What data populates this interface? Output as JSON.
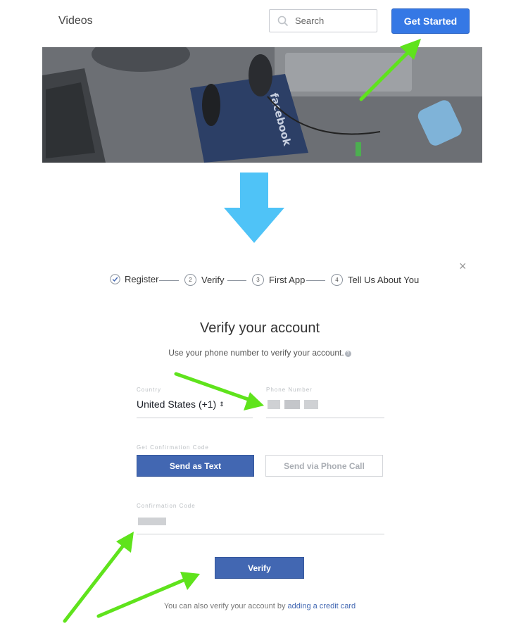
{
  "nav": {
    "videos_label": "Videos",
    "search_label": "Search",
    "get_started_label": "Get Started"
  },
  "hero": {
    "brand_text": "facebook"
  },
  "steps": [
    {
      "number": "",
      "label": "Register",
      "state": "done"
    },
    {
      "number": "2",
      "label": "Verify",
      "state": "current"
    },
    {
      "number": "3",
      "label": "First App",
      "state": "pending"
    },
    {
      "number": "4",
      "label": "Tell Us About You",
      "state": "pending"
    }
  ],
  "modal": {
    "close_icon": "×",
    "title": "Verify your account",
    "subtitle": "Use your phone number to verify your account.",
    "help_icon": "?"
  },
  "form": {
    "country_label": "Country",
    "country_value": "United States (+1)",
    "country_chevron": "⇕",
    "phone_label": "Phone Number",
    "confirmation_section_label": "Get Confirmation Code",
    "send_text_button": "Send as Text",
    "send_call_button": "Send via Phone Call",
    "code_label": "Confirmation Code",
    "verify_button": "Verify"
  },
  "footer": {
    "text": "You can also verify your account by ",
    "link": "adding a credit card"
  },
  "colors": {
    "annotation_arrow": "#5fe31c",
    "flow_arrow": "#4fc3f7",
    "primary_button": "#4267b2",
    "get_started_button": "#3578e5"
  }
}
